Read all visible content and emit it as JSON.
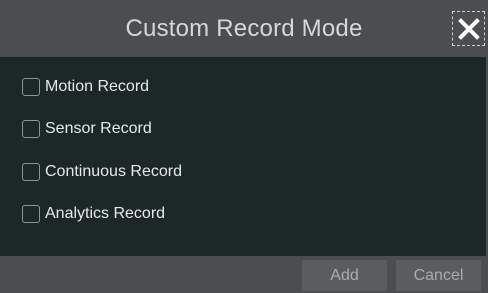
{
  "dialog": {
    "title": "Custom Record Mode",
    "close_icon": "close-icon"
  },
  "options": [
    {
      "label": "Motion Record",
      "checked": false
    },
    {
      "label": "Sensor Record",
      "checked": false
    },
    {
      "label": "Continuous Record",
      "checked": false
    },
    {
      "label": "Analytics Record",
      "checked": false
    }
  ],
  "footer": {
    "add_label": "Add",
    "cancel_label": "Cancel"
  },
  "colors": {
    "titlebar": "#4b4d51",
    "content_bg": "#1b2826",
    "text": "#e7e8e9"
  }
}
